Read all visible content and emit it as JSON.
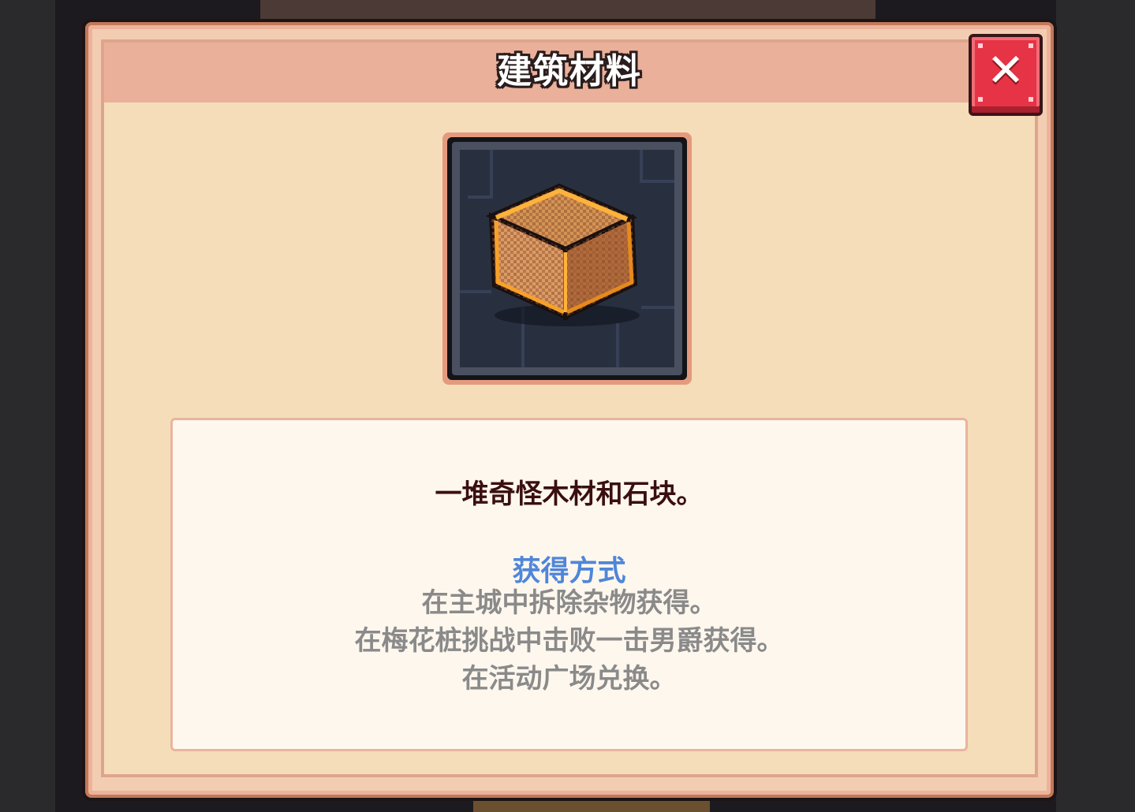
{
  "dialog": {
    "title": "建筑材料",
    "close_icon": "close-x-icon"
  },
  "item": {
    "icon": "building-material-crate-icon"
  },
  "description": {
    "text": "一堆奇怪木材和石块。",
    "obtain_title": "获得方式",
    "obtain_methods": [
      "在主城中拆除杂物获得。",
      "在梅花桩挑战中击败一击男爵获得。",
      "在活动广场兑换。"
    ]
  },
  "colors": {
    "frame": "#f3cdb2",
    "header_band": "#ebb09a",
    "panel": "#fef7ee",
    "obtain_title": "#4f86d9",
    "close_button": "#e63346"
  }
}
